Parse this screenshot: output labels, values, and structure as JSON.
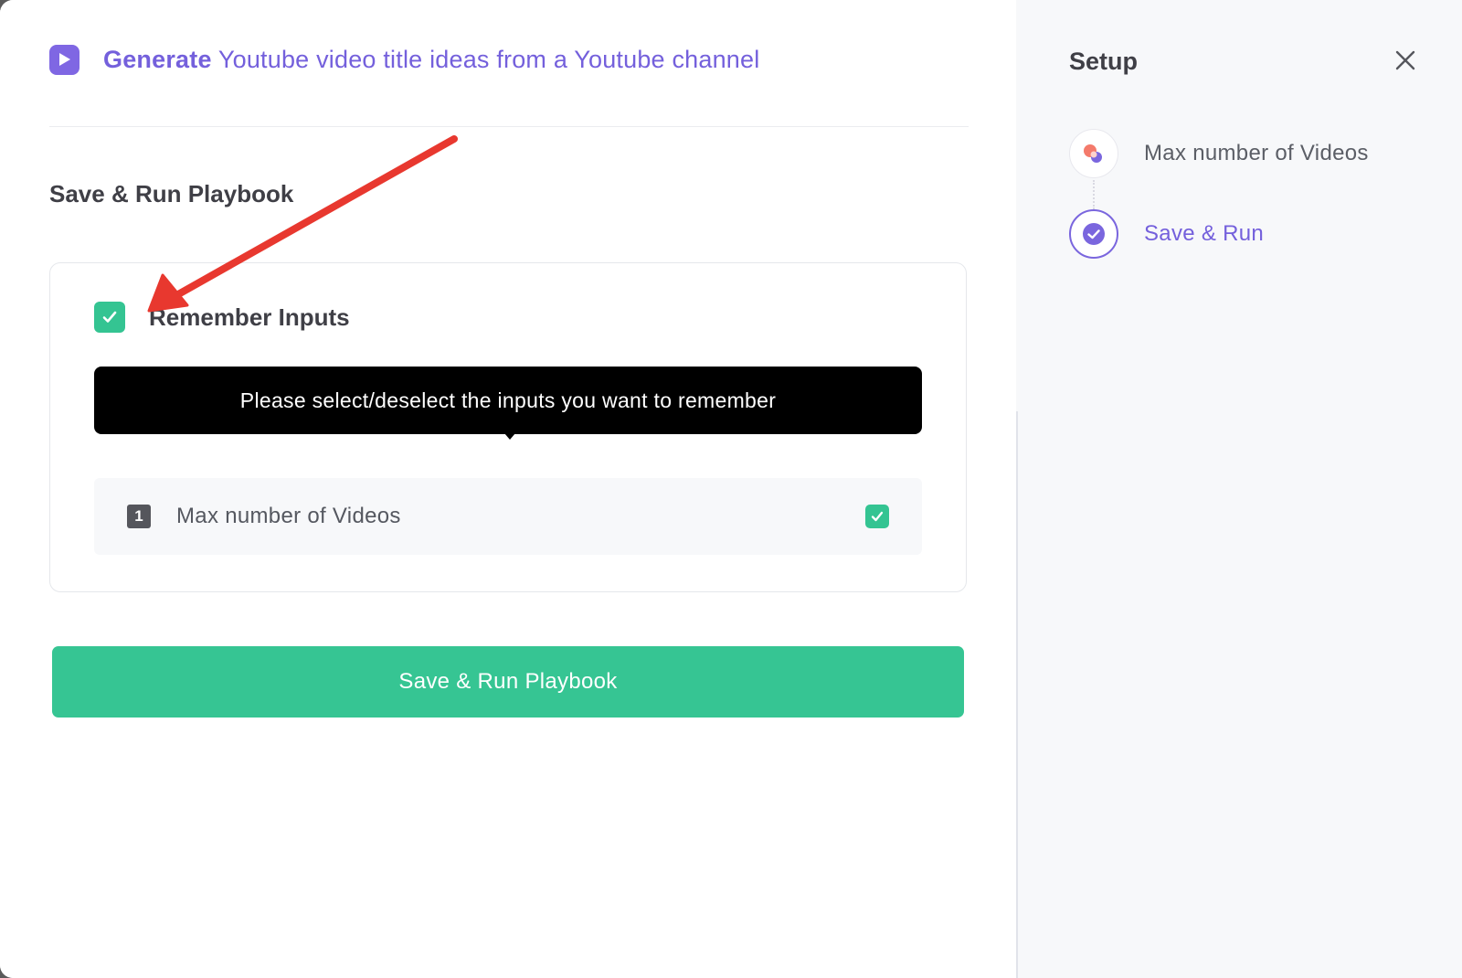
{
  "header": {
    "title_strong": "Generate",
    "title_rest": " Youtube video title ideas from a Youtube channel",
    "icon": "play-icon"
  },
  "main": {
    "section_title": "Save & Run Playbook",
    "remember": {
      "label": "Remember Inputs",
      "checked": true
    },
    "tooltip": "Please select/deselect the inputs you want to remember",
    "inputs": [
      {
        "number": "1",
        "label": "Max number of Videos",
        "checked": true
      }
    ],
    "run_button_label": "Save & Run Playbook"
  },
  "sidebar": {
    "title": "Setup",
    "close_icon": "close-icon",
    "steps": [
      {
        "label": "Max number of Videos",
        "icon": "shapes-icon",
        "state": "inactive"
      },
      {
        "label": "Save & Run",
        "icon": "check-circle-icon",
        "state": "active"
      }
    ]
  },
  "colors": {
    "accent_purple": "#7460dc",
    "success_green": "#34c492",
    "annotation_red": "#e8382f"
  }
}
